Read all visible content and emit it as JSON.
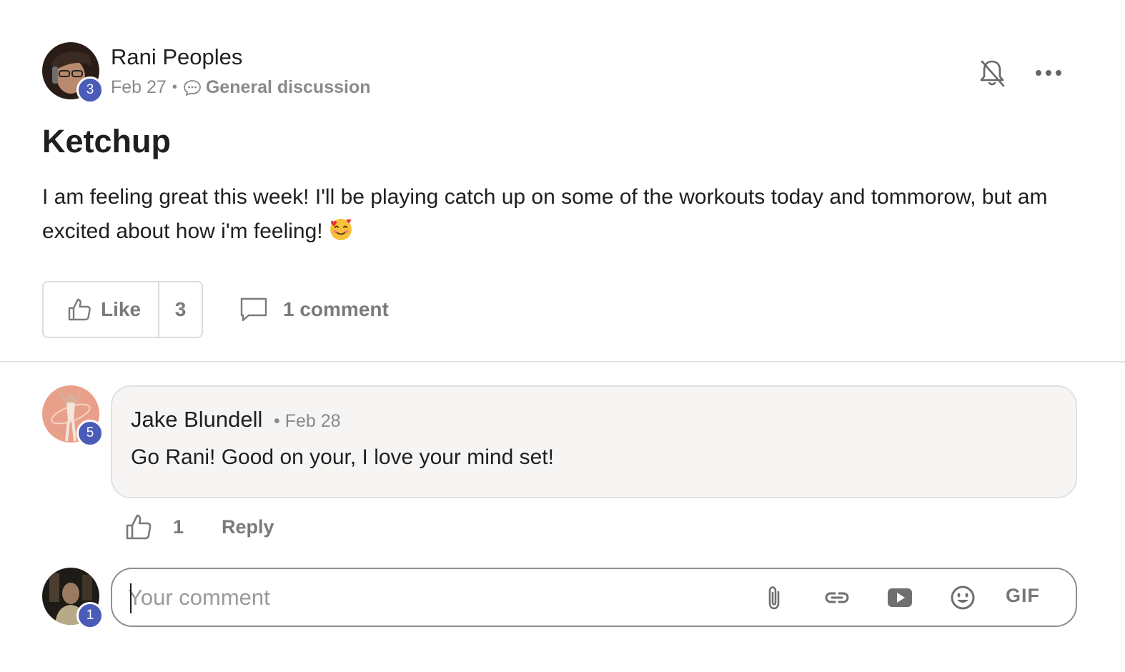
{
  "post": {
    "author": {
      "name": "Rani Peoples",
      "level": "3"
    },
    "date": "Feb 27",
    "separator": "•",
    "category": "General discussion",
    "title": "Ketchup",
    "body": "I am feeling great this week! I'll be playing catch up on some of the workouts today and tommorow, but am excited about how i'm feeling!",
    "body_emoji": "smiling-face-with-hearts",
    "like_label": "Like",
    "like_count": "3",
    "comment_label": "1 comment",
    "icons": {
      "notify": "bell-off-icon",
      "more": "more-options-icon",
      "category": "speech-bubble-icon",
      "like": "thumbs-up-icon",
      "comment": "comment-icon"
    }
  },
  "comment": {
    "author": {
      "name": "Jake Blundell",
      "level": "5"
    },
    "date": "• Feb 28",
    "text": "Go Rani! Good on your, I love your mind set!",
    "like_count": "1",
    "reply_label": "Reply"
  },
  "composer": {
    "user_level": "1",
    "placeholder": "Your comment",
    "gif_label": "GIF",
    "tools": [
      "attachment-icon",
      "link-icon",
      "video-icon",
      "emoji-icon"
    ]
  },
  "colors": {
    "badge": "#4a5bb8",
    "muted_text": "#8a8a8a",
    "bubble_bg": "#f6f5f4",
    "border": "#dcdcdc"
  }
}
